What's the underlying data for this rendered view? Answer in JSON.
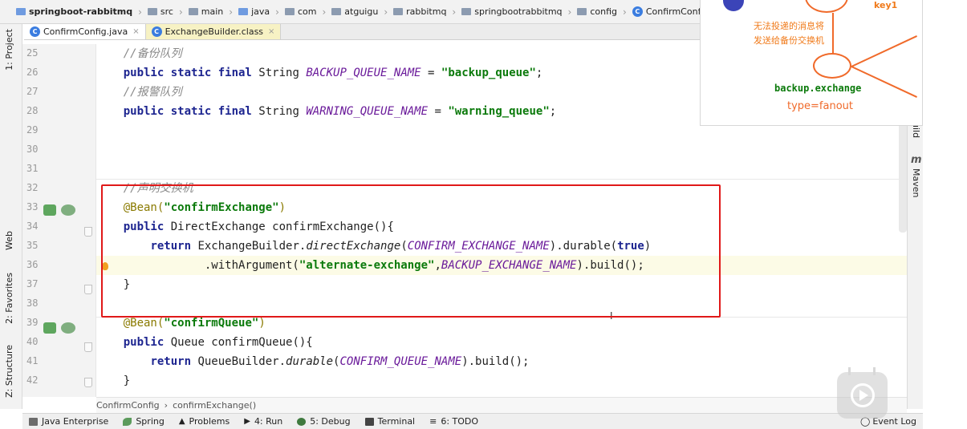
{
  "breadcrumb": [
    {
      "label": "springboot-rabbitmq",
      "icon": "project-folder-icon"
    },
    {
      "label": "src",
      "icon": "folder-icon"
    },
    {
      "label": "main",
      "icon": "folder-icon"
    },
    {
      "label": "java",
      "icon": "source-folder-icon"
    },
    {
      "label": "com",
      "icon": "package-icon"
    },
    {
      "label": "atguigu",
      "icon": "package-icon"
    },
    {
      "label": "rabbitmq",
      "icon": "package-icon"
    },
    {
      "label": "springbootrabbitmq",
      "icon": "package-icon"
    },
    {
      "label": "config",
      "icon": "package-icon"
    },
    {
      "label": "ConfirmConfig",
      "icon": "class-icon"
    }
  ],
  "tabs": [
    {
      "label": "ConfirmConfig.java",
      "close": "×"
    },
    {
      "label": "ExchangeBuilder.class",
      "close": "×"
    }
  ],
  "left_tools": {
    "project": "1: Project",
    "web": "Web",
    "favorites": "2: Favorites",
    "structure": "Z: Structure"
  },
  "right_tools": {
    "build": "uild",
    "maven_icon": "m",
    "maven": "Maven"
  },
  "code": {
    "line_numbers": [
      "25",
      "26",
      "27",
      "28",
      "29",
      "30",
      "31",
      "32",
      "33",
      "34",
      "35",
      "36",
      "37",
      "38",
      "39",
      "40",
      "41",
      "42"
    ],
    "l25": "//备份队列",
    "l26_kw": "public static final",
    "l26_type": " String ",
    "l26_const": "BACKUP_QUEUE_NAME",
    "l26_eq": " = ",
    "l26_str": "\"backup_queue\"",
    "l26_end": ";",
    "l27": "//报警队列",
    "l28_kw": "public static final",
    "l28_type": " String ",
    "l28_const": "WARNING_QUEUE_NAME",
    "l28_eq": " = ",
    "l28_str": "\"warning_queue\"",
    "l28_end": ";",
    "l32": "//声明交换机",
    "l33_ann": "@Bean(",
    "l33_str": "\"confirmExchange\"",
    "l33_end": ")",
    "l34_kw": "public",
    "l34_rest": " DirectExchange confirmExchange(){",
    "l35_kw": "return",
    "l35_a": " ExchangeBuilder.",
    "l35_m": "directExchange",
    "l35_p": "(",
    "l35_const": "CONFIRM_EXCHANGE_NAME",
    "l35_b": ").durable(",
    "l35_true": "true",
    "l35_c": ")",
    "l36_a": ".withArgument(",
    "l36_str": "\"alternate-exchange\"",
    "l36_comma": ",",
    "l36_const": "BACKUP_EXCHANGE_NAME",
    "l36_end": ").build();",
    "l37": "}",
    "l39_ann": "@Bean(",
    "l39_str": "\"confirmQueue\"",
    "l39_end": ")",
    "l40_kw": "public",
    "l40_rest": " Queue confirmQueue(){",
    "l41_kw": "return",
    "l41_a": " QueueBuilder.",
    "l41_m": "durable",
    "l41_p": "(",
    "l41_const": "CONFIRM_QUEUE_NAME",
    "l41_end": ").build();",
    "l42": "}"
  },
  "diagram": {
    "key": "key1",
    "note_line1": "无法投递的消息将",
    "note_line2": "发送给备份交换机",
    "exchange_name": "backup.exchange",
    "exchange_type": "type=fanout",
    "accent": "#f06a2a"
  },
  "editor_crumbs": {
    "class": "ConfirmConfig",
    "sep": "›",
    "method": "confirmExchange()"
  },
  "statusbar": [
    {
      "label": "Java Enterprise",
      "icon": "java-enterprise-icon"
    },
    {
      "label": "Spring",
      "icon": "spring-icon"
    },
    {
      "label": "Problems",
      "icon": "warning-icon"
    },
    {
      "label": "4: Run",
      "icon": "run-icon"
    },
    {
      "label": "5: Debug",
      "icon": "debug-icon"
    },
    {
      "label": "Terminal",
      "icon": "terminal-icon"
    },
    {
      "label": "6: TODO",
      "icon": "todo-icon"
    }
  ],
  "event_log": "Event Log",
  "cursor_glyph": "I",
  "colors": {
    "highlight_box": "#e01919",
    "keyword": "#1d2590",
    "string": "#0b7a0b",
    "constant": "#6a1a9a",
    "comment": "#8a8a8a"
  }
}
